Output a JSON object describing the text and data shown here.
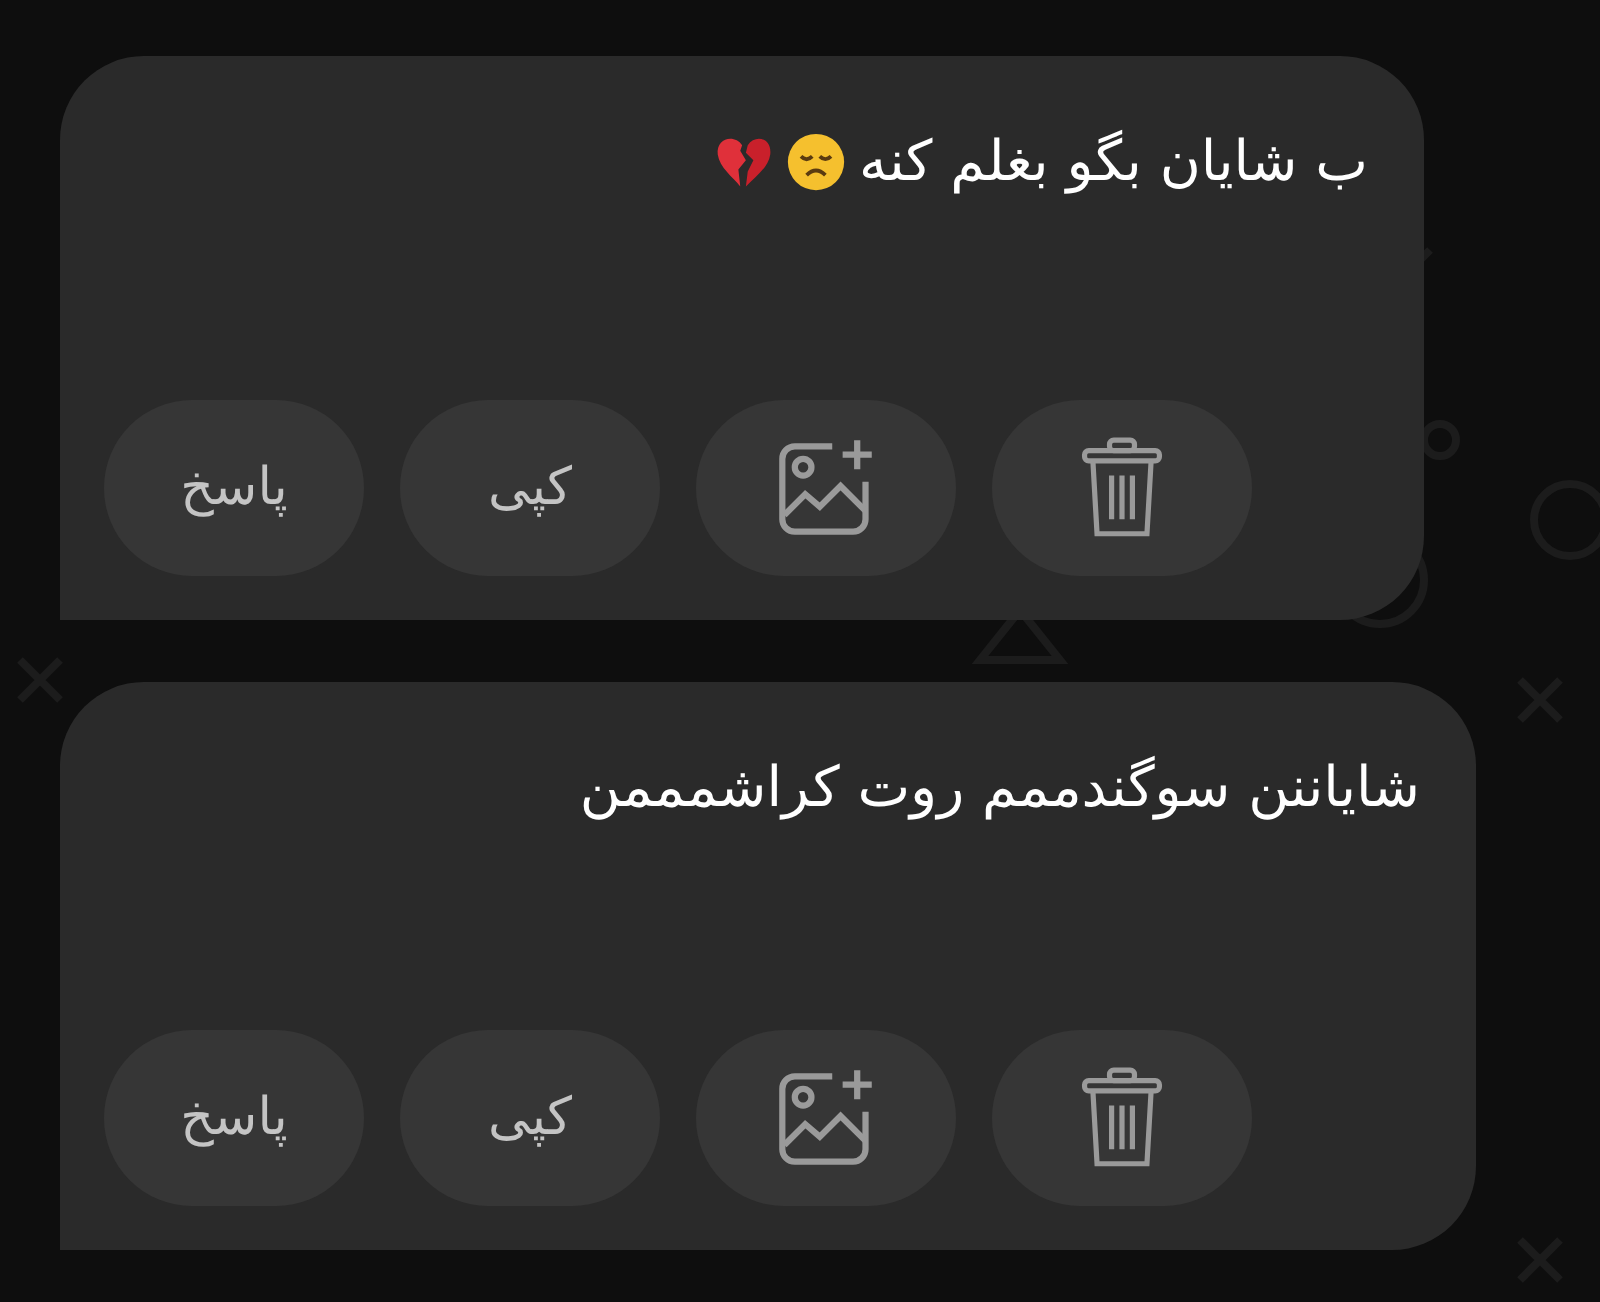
{
  "messages": [
    {
      "text": "ب شایان بگو بغلم کنه",
      "emoji": [
        {
          "kind": "sad-face"
        },
        {
          "kind": "broken-heart"
        }
      ],
      "actions": [
        {
          "kind": "delete"
        },
        {
          "kind": "add-image"
        },
        {
          "kind": "text",
          "label": "کپی"
        },
        {
          "kind": "text",
          "label": "پاسخ"
        }
      ]
    },
    {
      "text": "شایاننن سوگندممم روت کراشمممن",
      "actions": [
        {
          "kind": "delete"
        },
        {
          "kind": "add-image"
        },
        {
          "kind": "text",
          "label": "کپی"
        },
        {
          "kind": "text",
          "label": "پاسخ"
        }
      ]
    }
  ]
}
